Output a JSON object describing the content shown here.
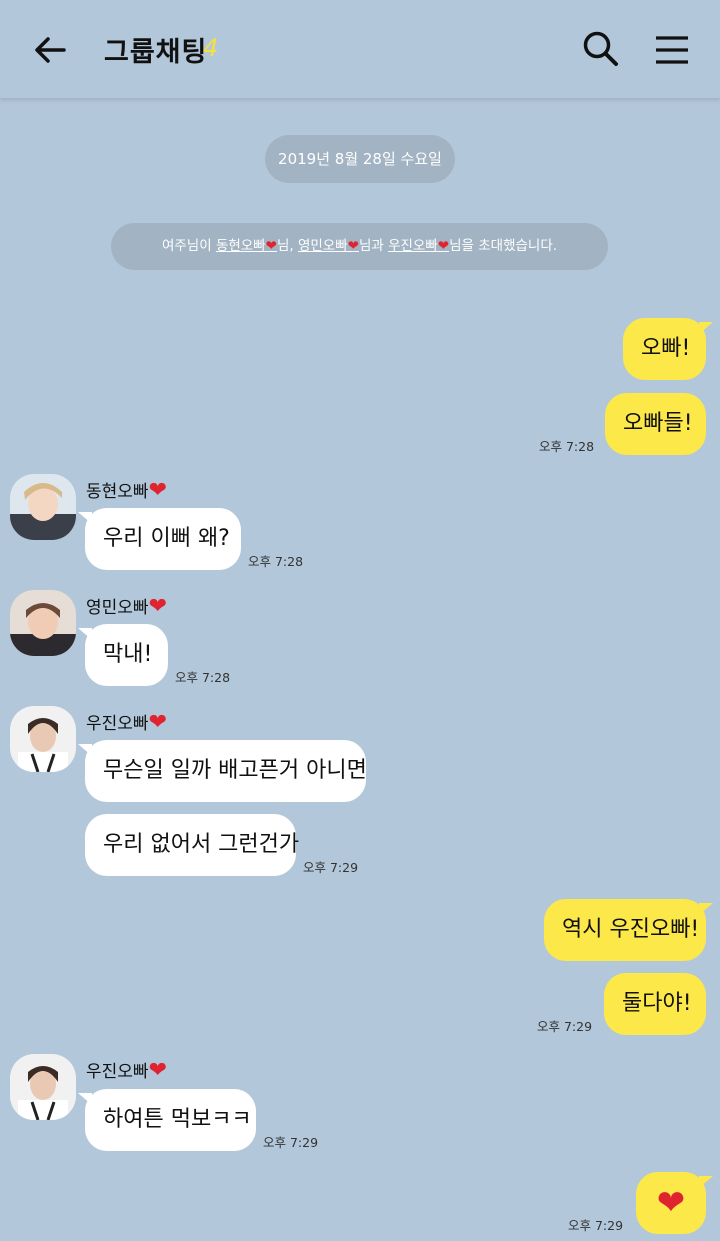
{
  "header": {
    "back_icon": "arrow-left-icon",
    "title": "그룹채팅",
    "member_count": "4",
    "search_icon": "search-icon",
    "menu_icon": "hamburger-menu-icon"
  },
  "date_divider": "2019년 8월 28일 수요일",
  "notice": {
    "prefix": "여주님이 ",
    "name1": "동현오빠",
    "sep1": "님, ",
    "name2": "영민오빠",
    "sep2": "님과 ",
    "name3": "우진오빠",
    "suffix": "님을 초대했습니다."
  },
  "heart_glyph": "❤",
  "colors": {
    "background": "#b2c7da",
    "my_bubble": "#fde84a",
    "their_bubble": "#ffffff",
    "heart": "#e0242f"
  },
  "messages": {
    "m1": "오빠!",
    "m2": "오빠들!",
    "m2_time": "오후 7:28",
    "dh_name": "동현오빠",
    "dh_msg": "우리 이뻐 왜?",
    "dh_time": "오후 7:28",
    "ym_name": "영민오빠",
    "ym_msg": "막내!",
    "ym_time": "오후 7:28",
    "wj_name": "우진오빠",
    "wj_msg1": "무슨일 일까 배고픈거 아니면",
    "wj_msg2": "우리 없어서 그런건가",
    "wj_time": "오후 7:29",
    "m3": "역시 우진오빠!",
    "m4": "둘다야!",
    "m4_time": "오후 7:29",
    "wj2_name": "우진오빠",
    "wj2_msg": "하여튼 먹보ㅋㅋ",
    "wj2_time": "오후 7:29",
    "m5_time": "오후 7:29"
  }
}
